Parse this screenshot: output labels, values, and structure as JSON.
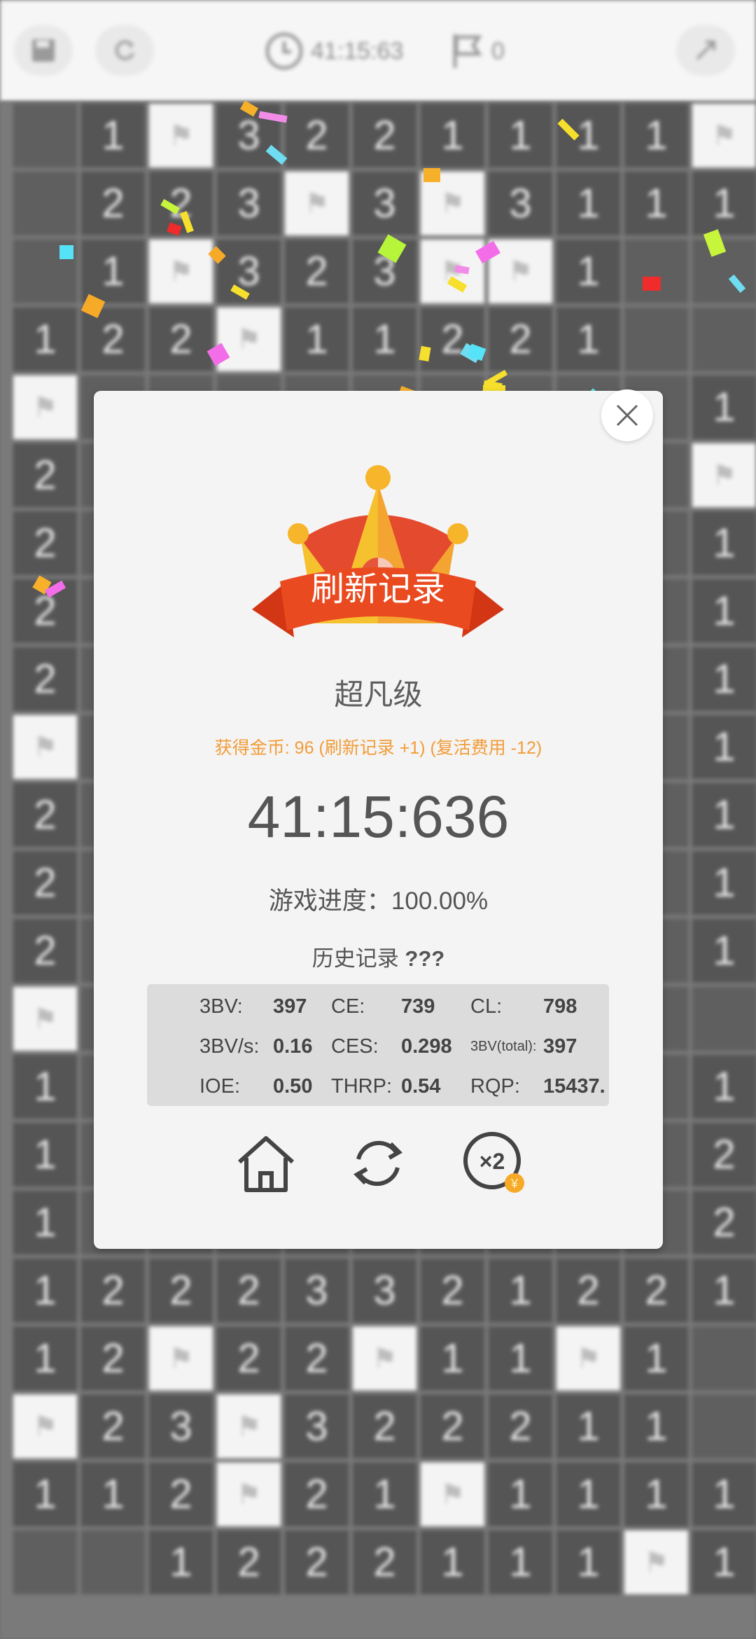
{
  "topbar": {
    "timer": "41:15:63",
    "flags": "0",
    "icons": [
      "save-icon",
      "refresh-icon",
      "clock-icon",
      "flag-icon",
      "expand-icon"
    ]
  },
  "board": {
    "rows": [
      [
        "",
        "1",
        "F",
        "3",
        "2",
        "2",
        "1",
        "1",
        "1",
        "1",
        "F"
      ],
      [
        "",
        "2",
        "2",
        "3",
        "F",
        "3",
        "F",
        "3",
        "1",
        "1",
        "1"
      ],
      [
        "",
        "1",
        "F",
        "3",
        "2",
        "3",
        "F",
        "F",
        "1",
        "",
        ""
      ],
      [
        "1",
        "2",
        "2",
        "F",
        "1",
        "1",
        "2",
        "2",
        "1",
        "",
        ""
      ],
      [
        "F",
        "",
        "",
        "",
        "",
        "",
        "",
        "",
        "",
        "",
        "1"
      ],
      [
        "2",
        "",
        "",
        "",
        "",
        "",
        "",
        "",
        "",
        "",
        "F"
      ],
      [
        "2",
        "",
        "",
        "",
        "",
        "",
        "",
        "",
        "",
        "",
        "1"
      ],
      [
        "2",
        "",
        "",
        "",
        "",
        "",
        "",
        "",
        "",
        "",
        "1"
      ],
      [
        "2",
        "",
        "",
        "",
        "",
        "",
        "",
        "",
        "",
        "",
        "1"
      ],
      [
        "F",
        "",
        "",
        "",
        "",
        "",
        "",
        "",
        "",
        "",
        "1"
      ],
      [
        "2",
        "",
        "",
        "",
        "",
        "",
        "",
        "",
        "",
        "",
        "1"
      ],
      [
        "2",
        "",
        "",
        "",
        "",
        "",
        "",
        "",
        "",
        "",
        "1"
      ],
      [
        "2",
        "",
        "",
        "",
        "",
        "",
        "",
        "",
        "",
        "",
        "1"
      ],
      [
        "F",
        "",
        "",
        "",
        "",
        "",
        "",
        "",
        "",
        "",
        ""
      ],
      [
        "1",
        "",
        "",
        "",
        "",
        "",
        "",
        "",
        "",
        "",
        "1"
      ],
      [
        "1",
        "",
        "",
        "",
        "",
        "",
        "",
        "",
        "",
        "",
        "2"
      ],
      [
        "1",
        "",
        "",
        "",
        "",
        "",
        "",
        "",
        "",
        "",
        "2"
      ],
      [
        "1",
        "2",
        "2",
        "2",
        "3",
        "3",
        "2",
        "1",
        "2",
        "2",
        "1"
      ],
      [
        "1",
        "2",
        "F",
        "2",
        "2",
        "F",
        "1",
        "1",
        "F",
        "1",
        ""
      ],
      [
        "F",
        "2",
        "3",
        "F",
        "3",
        "2",
        "2",
        "2",
        "1",
        "1",
        ""
      ],
      [
        "1",
        "1",
        "2",
        "F",
        "2",
        "1",
        "F",
        "1",
        "1",
        "1",
        "1"
      ],
      [
        "",
        "",
        "1",
        "2",
        "2",
        "2",
        "1",
        "1",
        "1",
        "F",
        "1"
      ]
    ]
  },
  "modal": {
    "banner": "刷新记录",
    "level": "超凡级",
    "coins_text": "获得金币: 96 (刷新记录 +1) (复活费用 -12)",
    "time": "41:15:636",
    "progress": "游戏进度：100.00%",
    "history_label": "历史记录 ",
    "history_value": "???",
    "stats": {
      "bv_label": "3BV:",
      "bv": "397",
      "ce_label": "CE:",
      "ce": "739",
      "cl_label": "CL:",
      "cl": "798",
      "bvs_label": "3BV/s:",
      "bvs": "0.16",
      "ces_label": "CES:",
      "ces": "0.298",
      "bvtotal_label": "3BV(total):",
      "bvtotal": "397",
      "ioe_label": "IOE:",
      "ioe": "0.50",
      "thrp_label": "THRP:",
      "thrp": "0.54",
      "rqp_label": "RQP:",
      "rqp": "15437."
    },
    "actions": [
      "home-icon",
      "replay-icon",
      "double-coins-icon"
    ],
    "double_label": "×2",
    "coin_symbol": "¥"
  },
  "colors": {
    "accent_orange": "#f29c38",
    "banner_red": "#e8411e",
    "crown_gold": "#f9b52c",
    "modal_bg": "#f4f4f4",
    "stats_bg": "#dcdcdc"
  }
}
